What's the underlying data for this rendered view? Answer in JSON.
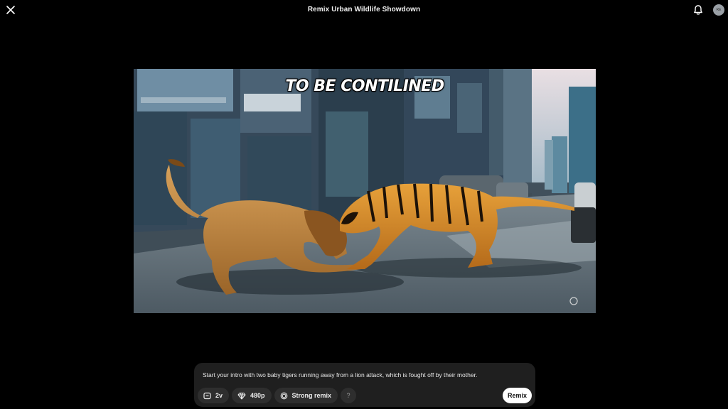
{
  "header": {
    "title": "Remix Urban Wildlife Showdown",
    "avatar_initials": "RE",
    "icons": [
      "close-icon",
      "bell-icon"
    ]
  },
  "video": {
    "overlay_caption": "TO BE CONTILINED"
  },
  "prompt": {
    "text": "Start your intro with two baby tigers running away from a lion attack, which is fought off by their mother.",
    "chips": [
      {
        "label": "2v",
        "icon": "variations-icon"
      },
      {
        "label": "480p",
        "icon": "diamond-icon"
      },
      {
        "label": "Strong remix",
        "icon": "remix-strength-icon"
      },
      {
        "label": "?",
        "icon": "help"
      }
    ],
    "submit_label": "Remix"
  },
  "colors": {
    "background": "#000000",
    "panel": "#1f1f1f",
    "chip": "#2e2e2e",
    "button": "#ffffff"
  }
}
